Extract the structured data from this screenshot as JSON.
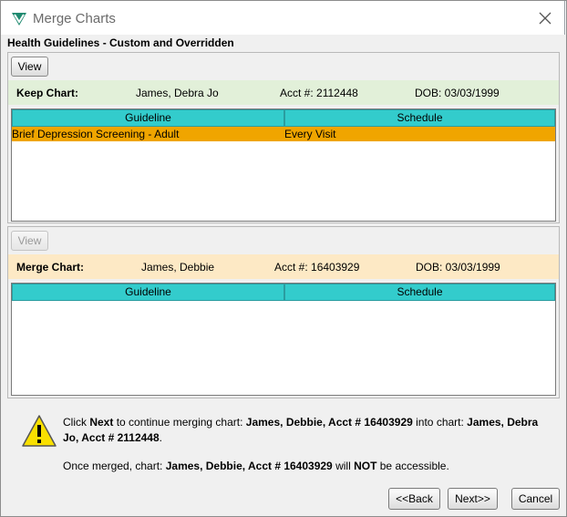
{
  "window": {
    "title": "Merge Charts",
    "app_icon": "app-logo-icon",
    "close_icon": "close-icon"
  },
  "section_title": "Health Guidelines - Custom and Overridden",
  "keep_panel": {
    "view_label": "View",
    "label": "Keep Chart:",
    "name": "James, Debra Jo",
    "acct": "Acct #: 2112448",
    "dob": "DOB: 03/03/1999",
    "columns": [
      "Guideline",
      "Schedule"
    ],
    "rows": [
      {
        "guideline": "Brief Depression Screening - Adult",
        "schedule": "Every Visit"
      }
    ]
  },
  "merge_panel": {
    "view_label": "View",
    "label": "Merge Chart:",
    "name": "James, Debbie",
    "acct": "Acct #: 16403929",
    "dob": "DOB: 03/03/1999",
    "columns": [
      "Guideline",
      "Schedule"
    ],
    "rows": []
  },
  "message": {
    "icon": "warning-icon",
    "line1_prefix": "Click ",
    "line1_next": "Next",
    "line1_mid": " to continue merging chart: ",
    "line1_source": "James, Debbie, Acct # 16403929",
    "line1_into": " into chart: ",
    "line1_target": "James, Debra Jo, Acct # 2112448",
    "line1_end": ".",
    "line2_prefix": "Once merged, chart: ",
    "line2_chart": "James, Debbie, Acct # 16403929",
    "line2_mid": " will ",
    "line2_not": "NOT",
    "line2_end": " be accessible."
  },
  "buttons": {
    "back": "<<Back",
    "next": "Next>>",
    "cancel": "Cancel"
  },
  "colors": {
    "grid_header": "#33cccc",
    "selected_row": "#f0a500",
    "keep_bar": "#e2f0d9",
    "merge_bar": "#fde9c5"
  }
}
